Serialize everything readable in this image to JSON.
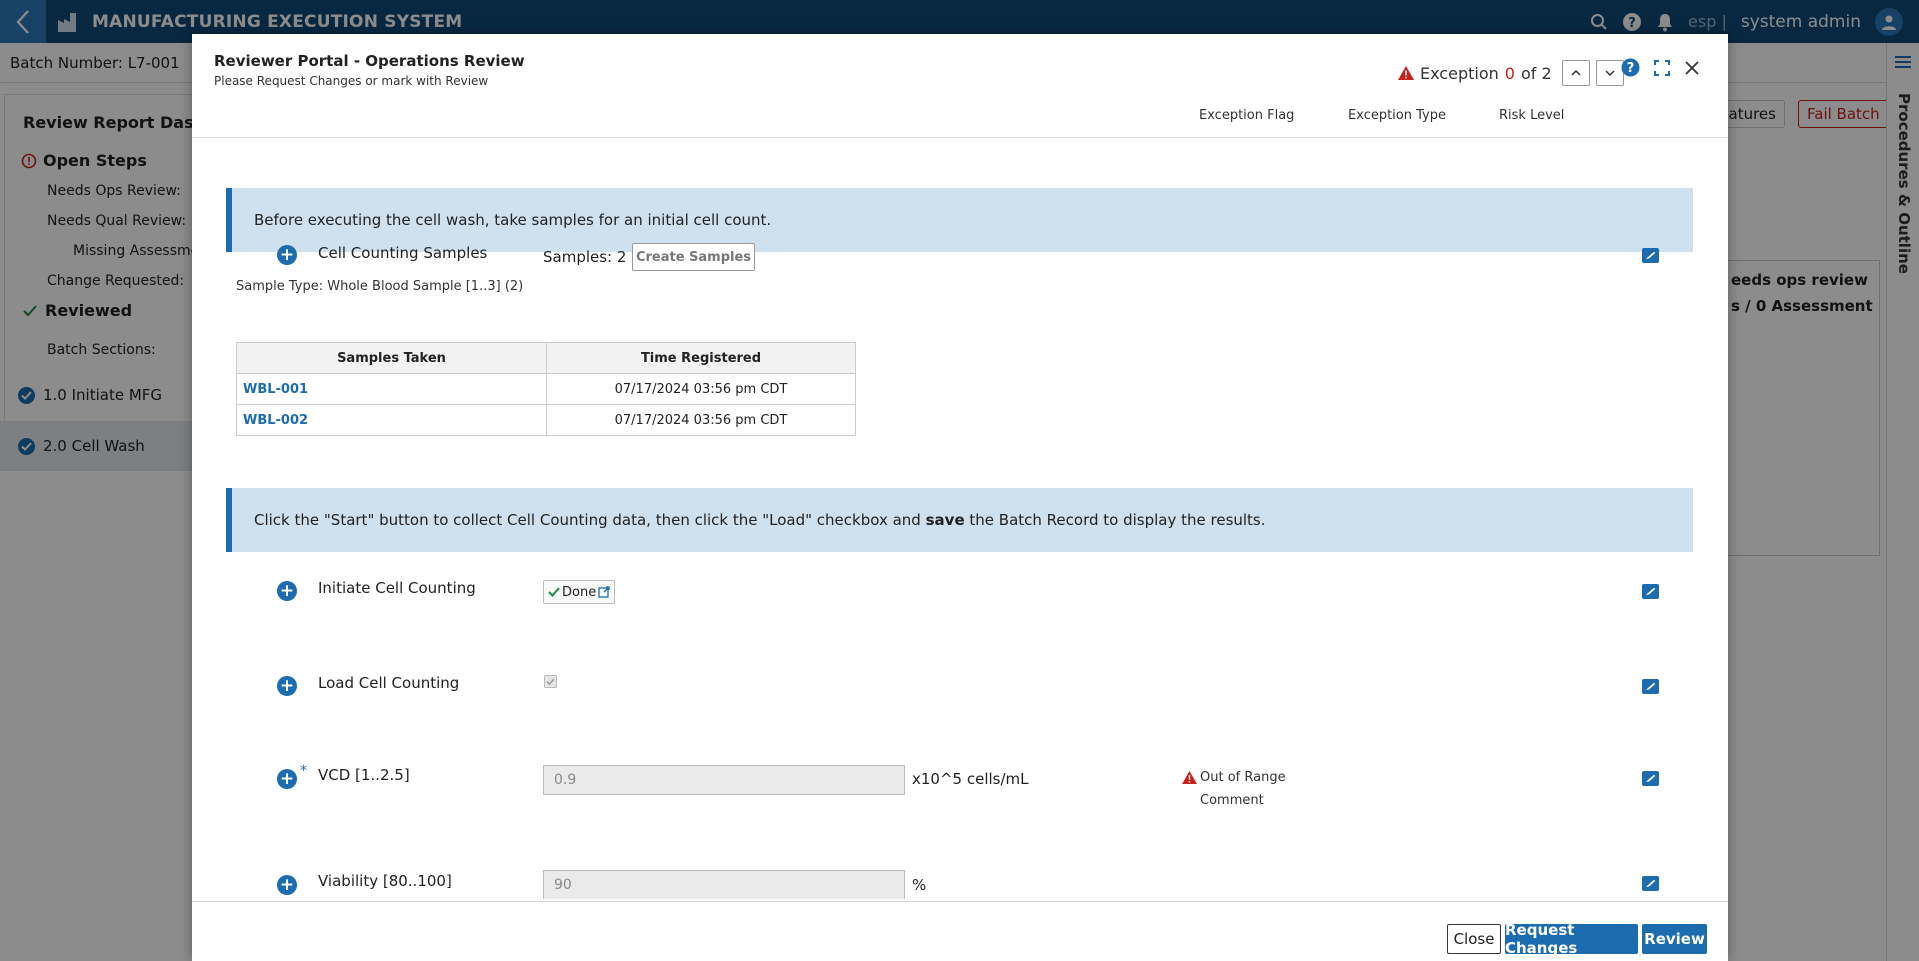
{
  "app": {
    "title": "MANUFACTURING EXECUTION SYSTEM",
    "lang": "esp |",
    "user": "system admin"
  },
  "batch": {
    "label": "Batch Number: L7-001"
  },
  "dashboard": {
    "title": "Review Report Dashboa",
    "open_steps": "Open Steps",
    "needs_ops": "Needs Ops Review:",
    "needs_qual": "Needs Qual Review:",
    "missing": "Missing Assessment",
    "change_req": "Change Requested:",
    "reviewed": "Reviewed",
    "batch_sections": "Batch Sections:"
  },
  "sections": [
    {
      "label": "1.0 Initiate MFG"
    },
    {
      "label": "2.0 Cell Wash"
    }
  ],
  "background_right": {
    "signatures_btn": "natures",
    "fail_batch_btn": "Fail Batch",
    "card_line1": "eeds ops review",
    "card_line2": "s / 0 Assessment",
    "outline_label": "Procedures & Outline"
  },
  "modal": {
    "title": "Reviewer Portal - Operations Review",
    "subtitle": "Please Request Changes or mark with Review",
    "exception_prefix": "Exception",
    "exception_current": "0",
    "exception_suffix": "of 2",
    "col_exception_flag": "Exception Flag",
    "col_exception_type": "Exception Type",
    "col_risk_level": "Risk Level",
    "note1": "Before executing the cell wash, take samples for an initial cell count.",
    "note2_a": "Click the \"Start\" button to collect Cell Counting data, then click the \"Load\" checkbox and ",
    "note2_bold": "save",
    "note2_b": " the Batch Record to display the results.",
    "cell_counting": {
      "label": "Cell Counting Samples",
      "samples_count": "Samples: 2",
      "create_btn": "Create Samples",
      "sample_type": "Sample Type: Whole Blood Sample [1..3] (2)",
      "columns": [
        "Samples Taken",
        "Time Registered"
      ],
      "rows": [
        {
          "id": "WBL-001",
          "time": "07/17/2024 03:56 pm CDT"
        },
        {
          "id": "WBL-002",
          "time": "07/17/2024 03:56 pm CDT"
        }
      ]
    },
    "initiate": {
      "label": "Initiate Cell Counting",
      "done": "Done"
    },
    "load": {
      "label": "Load Cell Counting",
      "checked": true
    },
    "vcd": {
      "label": "VCD [1..2.5]",
      "value": "0.9",
      "unit": "x10^5 cells/mL",
      "flag": "Out of Range",
      "flag2": "Comment"
    },
    "viability": {
      "label": "Viability [80..100]",
      "value": "90",
      "unit": "%"
    },
    "footer": {
      "close": "Close",
      "request_changes": "Request Changes",
      "review": "Review"
    }
  },
  "colors": {
    "brand": "#0f4a78",
    "accent": "#1d6cb0",
    "note_bg": "#cfe1ee",
    "error": "#c8201b"
  }
}
